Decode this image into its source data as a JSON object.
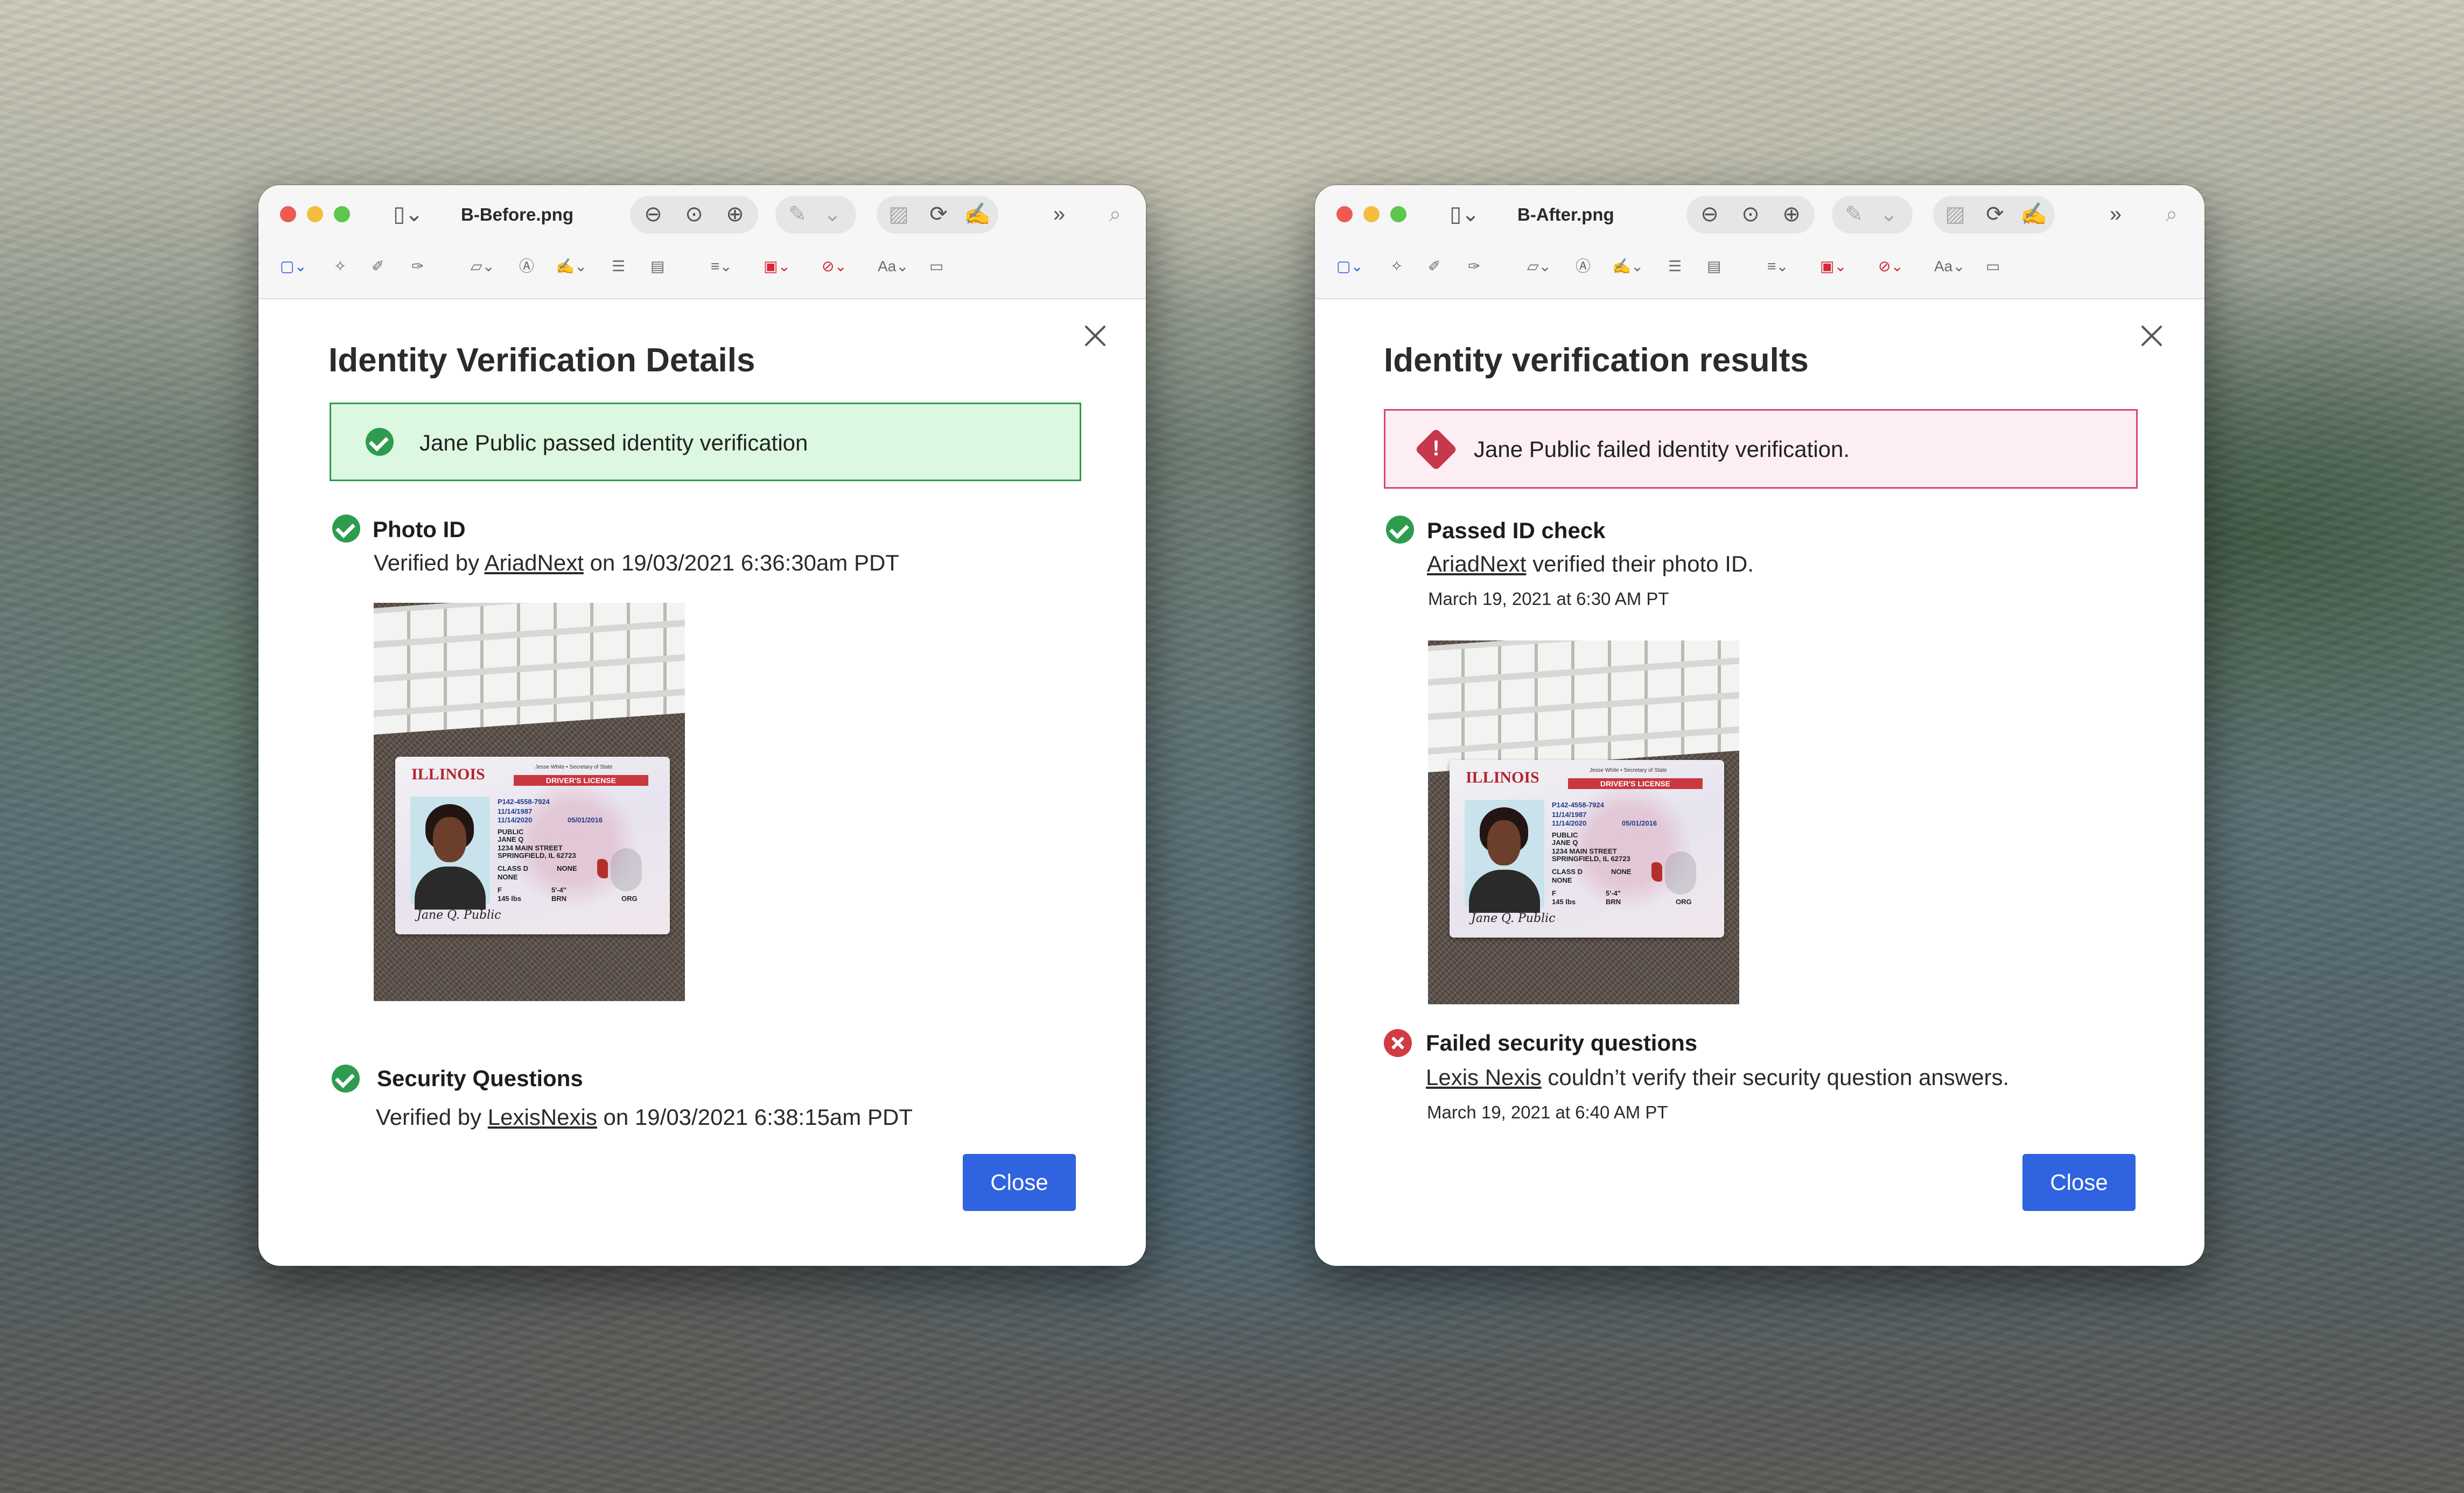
{
  "colors": {
    "success_green": "#2e9c4e",
    "success_bg": "#dcf8e0",
    "success_border": "#2f9c4b",
    "error_red": "#c6384b",
    "error_bg": "#fdeef4",
    "error_border": "#d84a6a",
    "button_blue": "#2f63e0"
  },
  "left_window": {
    "filename": "B-Before.png",
    "title": "Identity Verification Details",
    "banner": "Jane Public passed identity verification",
    "photo_id": {
      "title": "Photo ID",
      "prefix": "Verified by",
      "provider": "AriadNext",
      "suffix": "on 19/03/2021 6:36:30am PDT"
    },
    "security": {
      "title": "Security Questions",
      "prefix": "Verified by",
      "provider": "LexisNexis",
      "suffix": "on 19/03/2021 6:38:15am PDT"
    },
    "close_label": "Close"
  },
  "right_window": {
    "filename": "B-After.png",
    "title": "Identity verification results",
    "banner": "Jane Public failed identity verification.",
    "passed": {
      "title": "Passed ID check",
      "provider": "AriadNext",
      "suffix": "verified their photo ID.",
      "date": "March 19, 2021 at 6:30 AM PT"
    },
    "failed": {
      "title": "Failed security questions",
      "provider": "Lexis Nexis",
      "suffix": "couldn’t verify their security question answers.",
      "date": "March 19, 2021 at 6:40 AM PT"
    },
    "close_label": "Close"
  },
  "id_card": {
    "state": "ILLINOIS",
    "header": "DRIVER'S LICENSE",
    "issuer": "Jesse White • Secretary of State",
    "dl_no": "P142-4558-7924",
    "dob": "11/14/1987",
    "iss": "11/14/2020",
    "exp": "05/01/2016",
    "name_last": "PUBLIC",
    "name_first": "JANE Q",
    "address": "1234 MAIN STREET",
    "city": "SPRINGFIELD, IL 62723",
    "class": "CLASS D",
    "end": "NONE",
    "rest": "NONE",
    "sex": "F",
    "height": "5'-4\"",
    "weight": "145 lbs",
    "eyes": "BRN",
    "type": "ORG",
    "signature": "Jane Q. Public"
  },
  "toolbar_icons": [
    "sidebar-icon",
    "zoom-out-icon",
    "zoom-to-fit-icon",
    "zoom-in-icon",
    "markup-icon",
    "crop-icon",
    "rotate-icon",
    "signature-icon",
    "more-icon",
    "search-icon"
  ]
}
